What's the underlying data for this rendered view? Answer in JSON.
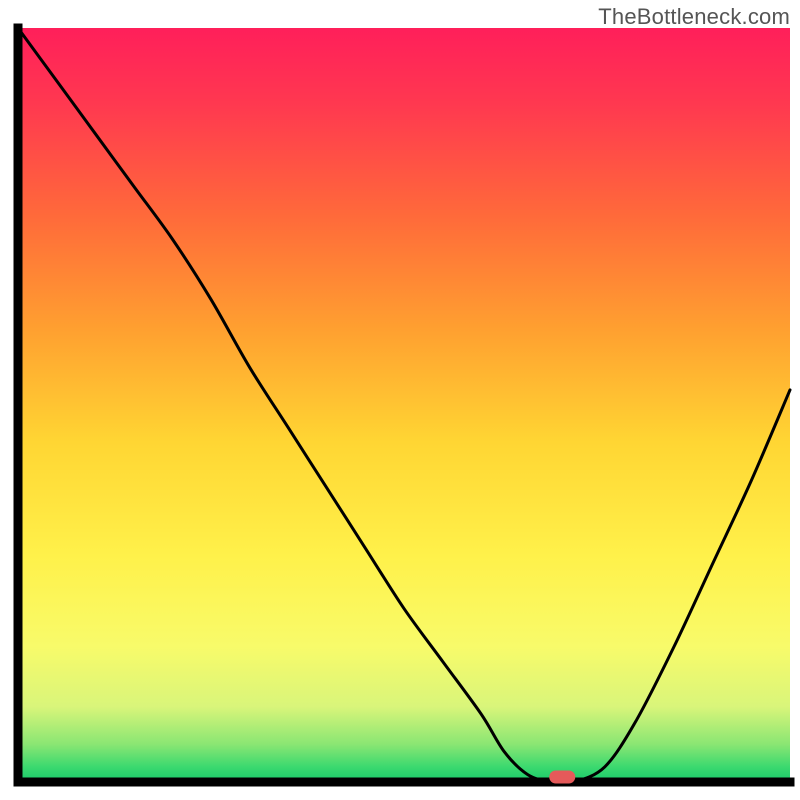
{
  "watermark": "TheBottleneck.com",
  "chart_data": {
    "type": "line",
    "title": "",
    "xlabel": "",
    "ylabel": "",
    "xlim": [
      0,
      100
    ],
    "ylim": [
      0,
      100
    ],
    "x": [
      0,
      5,
      10,
      15,
      20,
      25,
      30,
      35,
      40,
      45,
      50,
      55,
      60,
      63,
      66,
      69,
      72,
      76,
      80,
      85,
      90,
      95,
      100
    ],
    "values": [
      100,
      93,
      86,
      79,
      72,
      64,
      55,
      47,
      39,
      31,
      23,
      16,
      9,
      4,
      1,
      0,
      0,
      2,
      8,
      18,
      29,
      40,
      52
    ],
    "marker": {
      "x": 70.5,
      "y": 0
    },
    "gradient_stops": [
      {
        "offset": 0.0,
        "color": "#ff1f5a"
      },
      {
        "offset": 0.1,
        "color": "#ff3850"
      },
      {
        "offset": 0.25,
        "color": "#ff6a3a"
      },
      {
        "offset": 0.4,
        "color": "#ffa030"
      },
      {
        "offset": 0.55,
        "color": "#ffd633"
      },
      {
        "offset": 0.7,
        "color": "#fff14a"
      },
      {
        "offset": 0.82,
        "color": "#f8fb6a"
      },
      {
        "offset": 0.9,
        "color": "#d9f57a"
      },
      {
        "offset": 0.95,
        "color": "#8ae673"
      },
      {
        "offset": 0.98,
        "color": "#3bd96f"
      },
      {
        "offset": 1.0,
        "color": "#18c96a"
      }
    ],
    "axis_color": "#000000",
    "line_color": "#000000",
    "marker_color": "#e55a5a"
  }
}
